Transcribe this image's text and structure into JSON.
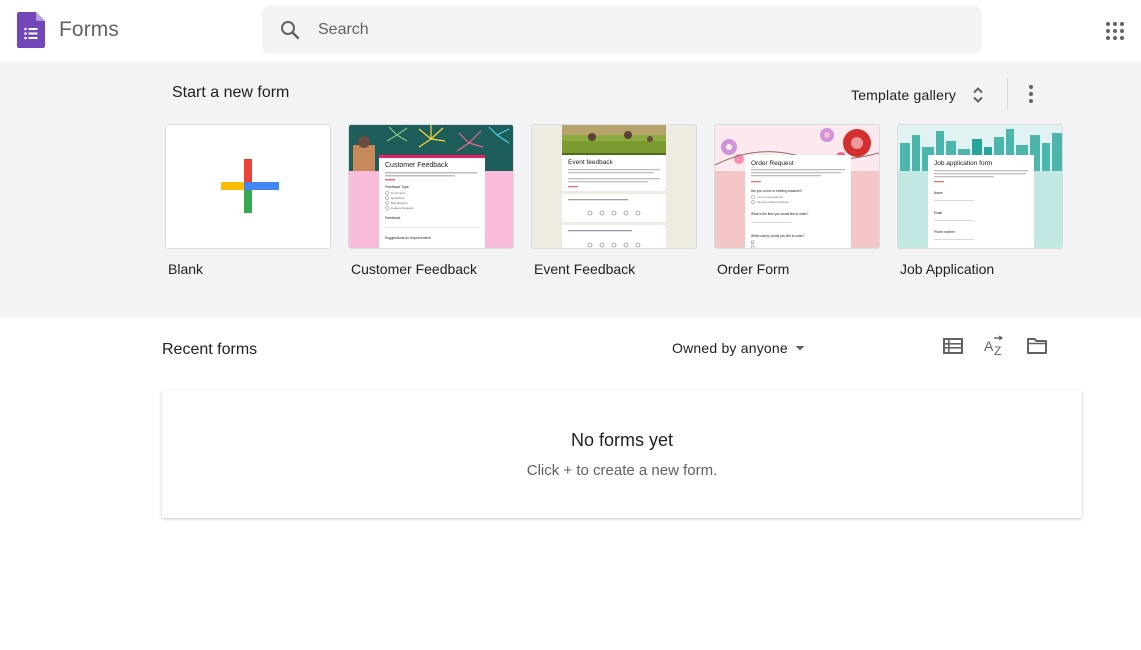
{
  "header": {
    "app_title": "Forms",
    "search_placeholder": "Search"
  },
  "templates": {
    "heading": "Start a new form",
    "gallery_label": "Template gallery",
    "items": [
      {
        "label": "Blank"
      },
      {
        "label": "Customer Feedback",
        "preview_title": "Customer Feedback",
        "preview_fields": [
          "Feedback Type",
          "Comments",
          "Questions",
          "Bug Reports",
          "Feature Request",
          "Feedback",
          "Suggestions for improvement"
        ]
      },
      {
        "label": "Event Feedback",
        "preview_title": "Event feedback"
      },
      {
        "label": "Order Form",
        "preview_title": "Order Request",
        "preview_fields": [
          "Are you a new or existing customer?",
          "I am a new customer",
          "I am an existing customer",
          "What is the item you would like to order?",
          "What color(s) would you like to order?"
        ]
      },
      {
        "label": "Job Application",
        "preview_title": "Job application form",
        "preview_fields": [
          "Name",
          "Email",
          "Phone number"
        ]
      }
    ]
  },
  "recent": {
    "heading": "Recent forms",
    "owner_filter": "Owned by anyone",
    "empty_title": "No forms yet",
    "empty_subtitle": "Click + to create a new form."
  },
  "colors": {
    "forms_purple": "#7248b9",
    "plus_red": "#ea4335",
    "plus_blue": "#4285f4",
    "plus_green": "#34a853",
    "plus_yellow": "#fbbc04"
  }
}
